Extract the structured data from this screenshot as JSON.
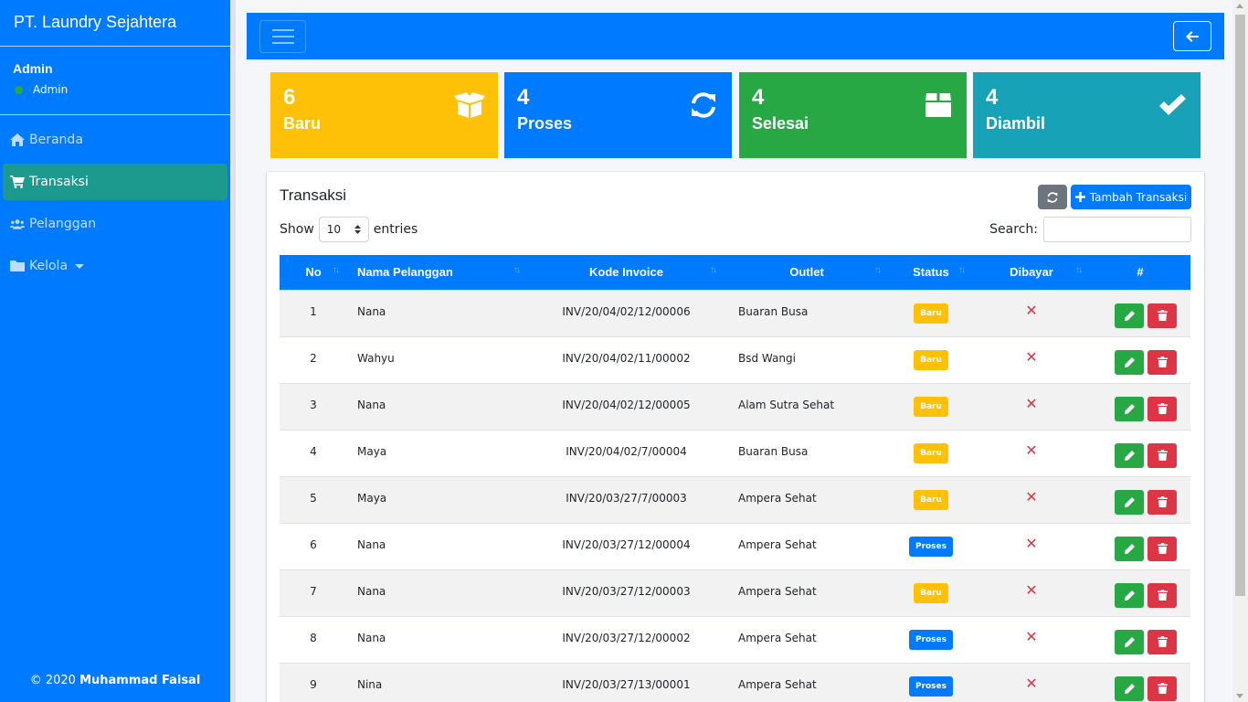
{
  "brand": "PT. Laundry Sejahtera",
  "user": {
    "name": "Admin",
    "status": "Admin",
    "status_color": "#28a745"
  },
  "nav": [
    {
      "label": "Beranda",
      "icon": "home-icon"
    },
    {
      "label": "Transaksi",
      "icon": "cart-icon",
      "active": true
    },
    {
      "label": "Pelanggan",
      "icon": "users-icon"
    },
    {
      "label": "Kelola",
      "icon": "folder-icon"
    }
  ],
  "footer": {
    "prefix": "© 2020",
    "author": "Muhammad Faisal"
  },
  "stats": [
    {
      "count": "6",
      "label": "Baru",
      "icon": "box-open-icon",
      "color": "#ffc107"
    },
    {
      "count": "4",
      "label": "Proses",
      "icon": "sync-icon",
      "color": "#007bff"
    },
    {
      "count": "4",
      "label": "Selesai",
      "icon": "box-icon",
      "color": "#28a745"
    },
    {
      "count": "4",
      "label": "Diambil",
      "icon": "check-icon",
      "color": "#17a2b8"
    }
  ],
  "card": {
    "title": "Transaksi",
    "add_label": "Tambah Transaksi",
    "show_label": "Show",
    "page_length": "10",
    "entries_label": "entries",
    "search_label": "Search:",
    "search_value": ""
  },
  "table": {
    "headers": [
      "No",
      "Nama Pelanggan",
      "Kode Invoice",
      "Outlet",
      "Status",
      "Dibayar",
      "#"
    ],
    "rows": [
      {
        "no": "1",
        "nama": "Nana",
        "kode": "INV/20/04/02/12/00006",
        "outlet": "Buaran Busa",
        "status": "Baru"
      },
      {
        "no": "2",
        "nama": "Wahyu",
        "kode": "INV/20/04/02/11/00002",
        "outlet": "Bsd Wangi",
        "status": "Baru"
      },
      {
        "no": "3",
        "nama": "Nana",
        "kode": "INV/20/04/02/12/00005",
        "outlet": "Alam Sutra Sehat",
        "status": "Baru"
      },
      {
        "no": "4",
        "nama": "Maya",
        "kode": "INV/20/04/02/7/00004",
        "outlet": "Buaran Busa",
        "status": "Baru"
      },
      {
        "no": "5",
        "nama": "Maya",
        "kode": "INV/20/03/27/7/00003",
        "outlet": "Ampera Sehat",
        "status": "Baru"
      },
      {
        "no": "6",
        "nama": "Nana",
        "kode": "INV/20/03/27/12/00004",
        "outlet": "Ampera Sehat",
        "status": "Proses"
      },
      {
        "no": "7",
        "nama": "Nana",
        "kode": "INV/20/03/27/12/00003",
        "outlet": "Ampera Sehat",
        "status": "Baru"
      },
      {
        "no": "8",
        "nama": "Nana",
        "kode": "INV/20/03/27/12/00002",
        "outlet": "Ampera Sehat",
        "status": "Proses"
      },
      {
        "no": "9",
        "nama": "Nina",
        "kode": "INV/20/03/27/13/00001",
        "outlet": "Ampera Sehat",
        "status": "Proses"
      }
    ]
  }
}
